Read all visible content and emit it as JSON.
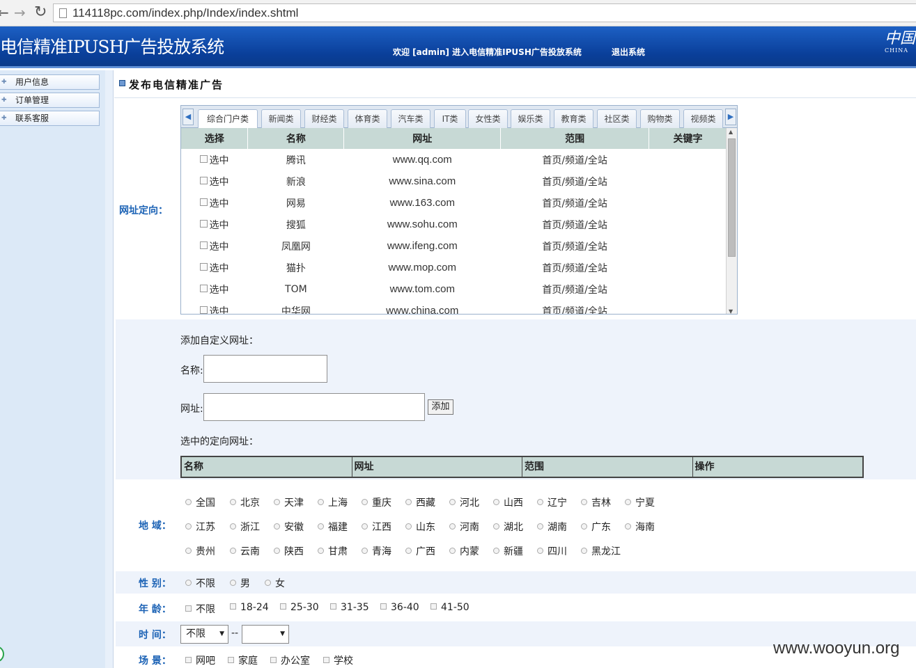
{
  "browser": {
    "back_icon": "arrow-left-icon",
    "forward_icon": "arrow-right-icon",
    "reload_icon": "reload-icon",
    "url": "114118pc.com/index.php/Index/index.shtml"
  },
  "header": {
    "title": "电信精准IPUSH广告投放系统",
    "welcome": "欢迎 [admin] 进入电信精准IPUSH广告投放系统",
    "logout": "退出系统",
    "logo_text": "中国",
    "logo_sub": "CHINA"
  },
  "sidebar": {
    "items": [
      {
        "label": "用户信息"
      },
      {
        "label": "订单管理"
      },
      {
        "label": "联系客服"
      }
    ]
  },
  "main": {
    "title": "发布电信精准广告",
    "url_target_label": "网址定向：",
    "tabs": [
      "综合门户类",
      "新闻类",
      "财经类",
      "体育类",
      "汽车类",
      "IT类",
      "女性类",
      "娱乐类",
      "教育类",
      "社区类",
      "购物类",
      "视频类"
    ],
    "site_table": {
      "headers": [
        "选择",
        "名称",
        "网址",
        "范围",
        "关键字"
      ],
      "select_label": "选中",
      "rows": [
        {
          "name": "腾讯",
          "url": "www.qq.com",
          "scope": "首页/频道/全站"
        },
        {
          "name": "新浪",
          "url": "www.sina.com",
          "scope": "首页/频道/全站"
        },
        {
          "name": "网易",
          "url": "www.163.com",
          "scope": "首页/频道/全站"
        },
        {
          "name": "搜狐",
          "url": "www.sohu.com",
          "scope": "首页/频道/全站"
        },
        {
          "name": "凤凰网",
          "url": "www.ifeng.com",
          "scope": "首页/频道/全站"
        },
        {
          "name": "猫扑",
          "url": "www.mop.com",
          "scope": "首页/频道/全站"
        },
        {
          "name": "TOM",
          "url": "www.tom.com",
          "scope": "首页/频道/全站"
        },
        {
          "name": "中华网",
          "url": "www.china.com",
          "scope": "首页/频道/全站"
        }
      ]
    },
    "custom": {
      "heading": "添加自定义网址：",
      "name_label": "名称:",
      "name_value": "",
      "url_label": "网址:",
      "url_value": "",
      "add_button": "添加",
      "chosen_heading": "选中的定向网址：",
      "chosen_headers": [
        "名称",
        "网址",
        "范围",
        "操作"
      ]
    },
    "region": {
      "label": "地 域：",
      "options": [
        [
          "全国",
          "北京",
          "天津",
          "上海",
          "重庆",
          "西藏",
          "河北",
          "山西",
          "辽宁",
          "吉林",
          "宁夏"
        ],
        [
          "江苏",
          "浙江",
          "安徽",
          "福建",
          "江西",
          "山东",
          "河南",
          "湖北",
          "湖南",
          "广东",
          "海南"
        ],
        [
          "贵州",
          "云南",
          "陕西",
          "甘肃",
          "青海",
          "广西",
          "内蒙",
          "新疆",
          "四川",
          "黑龙江"
        ]
      ]
    },
    "gender": {
      "label": "性 别：",
      "options": [
        "不限",
        "男",
        "女"
      ]
    },
    "age": {
      "label": "年 龄：",
      "options": [
        "不限",
        "18-24",
        "25-30",
        "31-35",
        "36-40",
        "41-50"
      ]
    },
    "time": {
      "label": "时 间：",
      "from_value": "不限",
      "separator": "--",
      "to_value": ""
    },
    "scene": {
      "label": "场 景：",
      "options": [
        "网吧",
        "家庭",
        "办公室",
        "学校"
      ]
    }
  },
  "watermark": "www.wooyun.org"
}
